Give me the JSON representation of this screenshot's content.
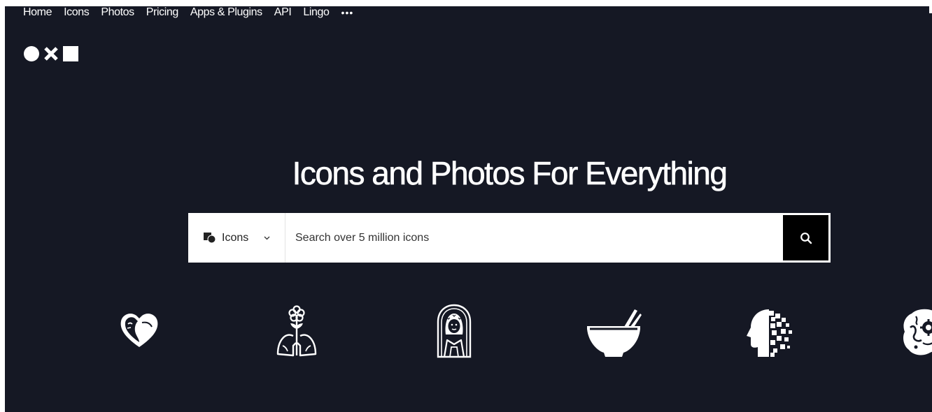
{
  "nav": {
    "items": [
      "Home",
      "Icons",
      "Photos",
      "Pricing",
      "Apps & Plugins",
      "API",
      "Lingo"
    ],
    "more": "•••"
  },
  "hero": {
    "title": "Icons and Photos For Everything"
  },
  "search": {
    "type_label": "Icons",
    "placeholder": "Search over 5 million icons"
  },
  "showcase": {
    "icons": [
      "heart-face-icon",
      "flower-lungs-icon",
      "woman-portrait-icon",
      "noodle-bowl-icon",
      "pixel-head-icon",
      "brain-gear-icon"
    ]
  },
  "colors": {
    "background": "#151824",
    "foreground": "#ffffff",
    "search_button": "#000000"
  }
}
